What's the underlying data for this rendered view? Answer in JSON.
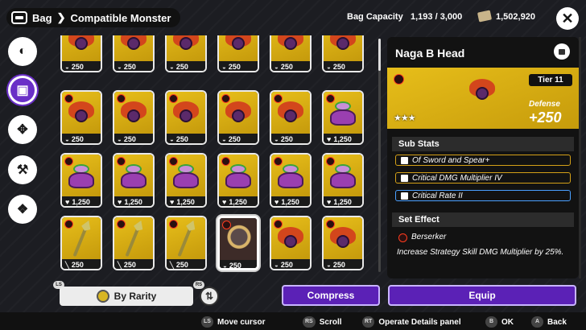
{
  "header": {
    "crumb_root": "Bag",
    "crumb_sep": "❯",
    "crumb_page": "Compatible Monster",
    "capacity_label": "Bag Capacity",
    "capacity_value": "1,193 / 3,000",
    "currency_value": "1,502,920",
    "close_symbol": "✕"
  },
  "sidebar": {
    "items": [
      {
        "name": "weapon-tab",
        "glyph": "◐",
        "active": false
      },
      {
        "name": "monster-tab",
        "glyph": "▣",
        "active": true
      },
      {
        "name": "gem-tab",
        "glyph": "✥",
        "active": false
      },
      {
        "name": "tool-tab",
        "glyph": "⚒",
        "active": false
      },
      {
        "name": "gift-tab",
        "glyph": "❖",
        "active": false
      }
    ]
  },
  "inventory": {
    "items": [
      {
        "kind": "head",
        "value": "250",
        "stat_icon": "defense-icon"
      },
      {
        "kind": "head",
        "value": "250",
        "stat_icon": "defense-icon"
      },
      {
        "kind": "head",
        "value": "250",
        "stat_icon": "defense-icon"
      },
      {
        "kind": "head",
        "value": "250",
        "stat_icon": "defense-icon"
      },
      {
        "kind": "head",
        "value": "250",
        "stat_icon": "defense-icon"
      },
      {
        "kind": "head",
        "value": "250",
        "stat_icon": "defense-icon"
      },
      {
        "kind": "head",
        "value": "250",
        "stat_icon": "defense-icon"
      },
      {
        "kind": "head",
        "value": "250",
        "stat_icon": "defense-icon"
      },
      {
        "kind": "head",
        "value": "250",
        "stat_icon": "defense-icon"
      },
      {
        "kind": "head",
        "value": "250",
        "stat_icon": "defense-icon"
      },
      {
        "kind": "head",
        "value": "250",
        "stat_icon": "defense-icon"
      },
      {
        "kind": "slime",
        "value": "1,250",
        "stat_icon": "heart-icon"
      },
      {
        "kind": "slime",
        "value": "1,250",
        "stat_icon": "heart-icon"
      },
      {
        "kind": "slime",
        "value": "1,250",
        "stat_icon": "heart-icon"
      },
      {
        "kind": "slime",
        "value": "1,250",
        "stat_icon": "heart-icon"
      },
      {
        "kind": "slime",
        "value": "1,250",
        "stat_icon": "heart-icon"
      },
      {
        "kind": "slime",
        "value": "1,250",
        "stat_icon": "heart-icon"
      },
      {
        "kind": "slime",
        "value": "1,250",
        "stat_icon": "heart-icon"
      },
      {
        "kind": "spear",
        "value": "250",
        "stat_icon": "sword-icon"
      },
      {
        "kind": "spear",
        "value": "250",
        "stat_icon": "sword-icon"
      },
      {
        "kind": "spear",
        "value": "250",
        "stat_icon": "sword-icon"
      },
      {
        "kind": "selected",
        "value": "250",
        "stat_icon": "defense-icon"
      },
      {
        "kind": "head",
        "value": "250",
        "stat_icon": "defense-icon"
      },
      {
        "kind": "head",
        "value": "250",
        "stat_icon": "defense-icon"
      }
    ]
  },
  "details": {
    "title": "Naga B Head",
    "tier": "Tier 11",
    "stars": "★★★",
    "stat_label": "Defense",
    "stat_value": "+250",
    "sub_stats_heading": "Sub Stats",
    "sub_stats": [
      {
        "label": "Of Sword and Spear+",
        "color": "#d4a017"
      },
      {
        "label": "Critical DMG Multiplier IV",
        "color": "#d4a017"
      },
      {
        "label": "Critical Rate II",
        "color": "#4aa0ff"
      }
    ],
    "set_effect_heading": "Set Effect",
    "set_name": "Berserker",
    "set_description": "Increase Strategy Skill DMG Multiplier by 25%."
  },
  "controls": {
    "rarity_label": "By Rarity",
    "rarity_left_key": "LS",
    "rarity_right_key": "RS",
    "sort_glyph": "⇅",
    "compress_label": "Compress",
    "equip_label": "Equip"
  },
  "hints": [
    {
      "key": "LS",
      "label": "Move cursor"
    },
    {
      "key": "RS",
      "label": "Scroll"
    },
    {
      "key": "RT",
      "label": "Operate Details panel"
    },
    {
      "key": "B",
      "label": "OK"
    },
    {
      "key": "A",
      "label": "Back"
    }
  ]
}
